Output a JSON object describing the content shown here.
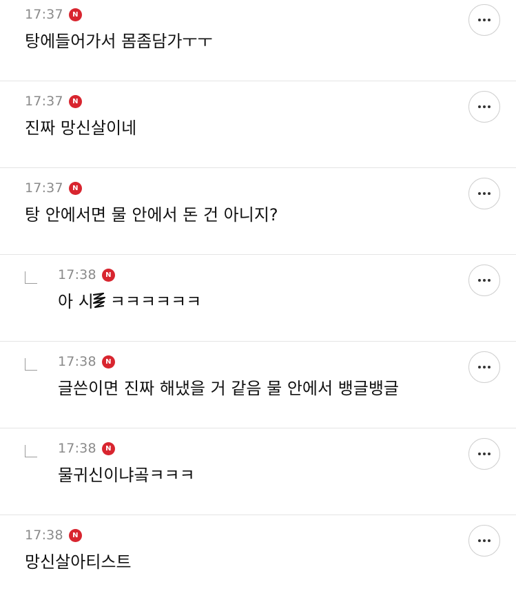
{
  "comments": [
    {
      "time": "17:37",
      "badge": "N",
      "text": "탕에들어가서 몸좀담가ㅜㅜ",
      "reply": false
    },
    {
      "time": "17:37",
      "badge": "N",
      "text": "진짜 망신살이네",
      "reply": false
    },
    {
      "time": "17:37",
      "badge": "N",
      "text": "탕 안에서면 물 안에서 돈 건 아니지?",
      "reply": false
    },
    {
      "time": "17:38",
      "badge": "N",
      "text_before": "아 시",
      "text_after": "ㅋㅋㅋㅋㅋㅋ",
      "reply": true
    },
    {
      "time": "17:38",
      "badge": "N",
      "text": "글쓴이면 진짜 해냈을 거 같음 물 안에서 뱅글뱅글",
      "reply": true
    },
    {
      "time": "17:38",
      "badge": "N",
      "text": "물귀신이냐곸ㅋㅋㅋ",
      "reply": true
    },
    {
      "time": "17:38",
      "badge": "N",
      "text": "망신살아티스트",
      "reply": false
    }
  ],
  "icons": {
    "more": "more-horizontal-icon",
    "reply": "reply-corner-icon",
    "badge": "new-badge-icon",
    "censor": "scribble-censor-icon"
  },
  "colors": {
    "badge": "#d8252f",
    "time": "#8a8a8a",
    "divider": "#e4e4e4"
  }
}
